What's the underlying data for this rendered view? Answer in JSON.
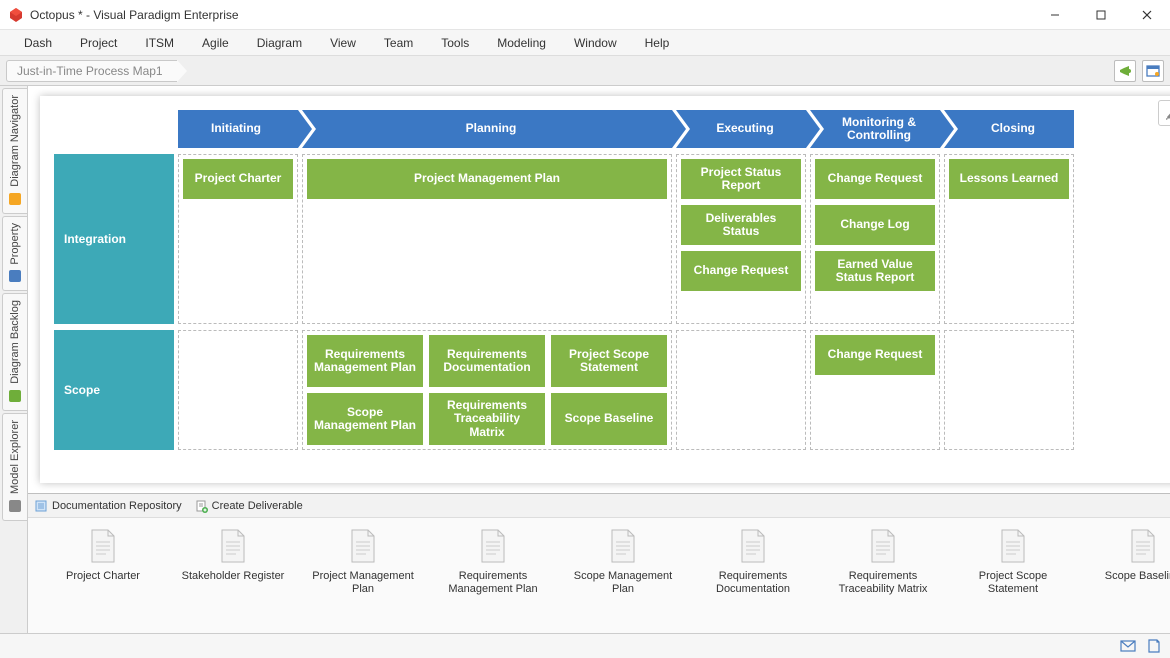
{
  "window": {
    "title": "Octopus * - Visual Paradigm Enterprise"
  },
  "menu": [
    "Dash",
    "Project",
    "ITSM",
    "Agile",
    "Diagram",
    "View",
    "Team",
    "Tools",
    "Modeling",
    "Window",
    "Help"
  ],
  "breadcrumb": {
    "current": "Just-in-Time Process Map1"
  },
  "side_tabs": [
    "Diagram Navigator",
    "Property",
    "Diagram Backlog",
    "Model Explorer"
  ],
  "phases": [
    "Initiating",
    "Planning",
    "Executing",
    "Monitoring & Controlling",
    "Closing"
  ],
  "rows": [
    {
      "label": "Integration",
      "cells": [
        [
          "Project Charter"
        ],
        [
          "Project Management Plan"
        ],
        [
          "Project Status Report",
          "Deliverables Status",
          "Change Request"
        ],
        [
          "Change Request",
          "Change Log",
          "Earned Value Status Report"
        ],
        [
          "Lessons Learned"
        ]
      ]
    },
    {
      "label": "Scope",
      "cells": [
        [],
        [
          "Requirements Management Plan",
          "Requirements Documentation",
          "Project Scope Statement",
          "Scope Management Plan",
          "Requirements Traceability Matrix",
          "Scope Baseline"
        ],
        [],
        [
          "Change Request"
        ],
        []
      ]
    }
  ],
  "deliv_toolbar": {
    "repo": "Documentation Repository",
    "create": "Create Deliverable"
  },
  "deliverables": [
    "Project Charter",
    "Stakeholder Register",
    "Project Management Plan",
    "Requirements Management Plan",
    "Scope Management Plan",
    "Requirements Documentation",
    "Requirements Traceability Matrix",
    "Project Scope Statement",
    "Scope Baseline"
  ]
}
